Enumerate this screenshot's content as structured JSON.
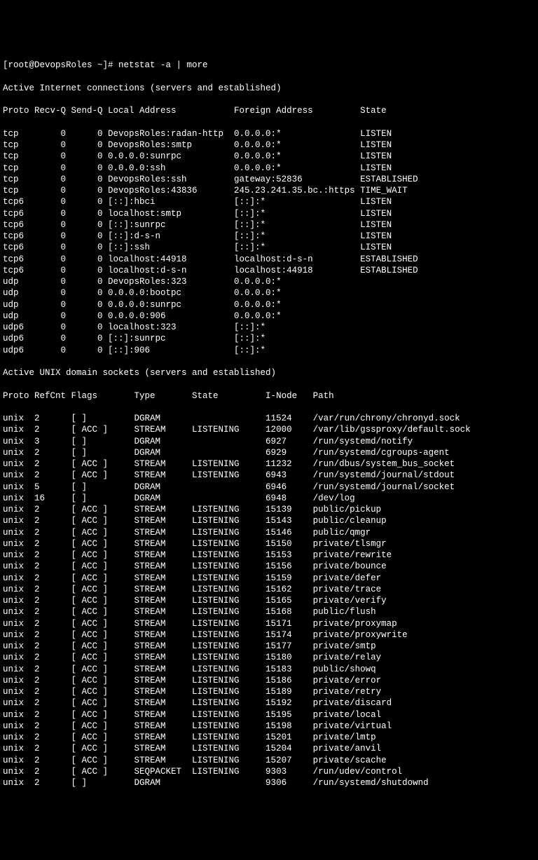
{
  "prompt": "[root@DevopsRoles ~]# netstat -a | more",
  "inet_header": "Active Internet connections (servers and established)",
  "inet_cols": "Proto Recv-Q Send-Q Local Address           Foreign Address         State",
  "inet_rows": [
    "tcp        0      0 DevopsRoles:radan-http  0.0.0.0:*               LISTEN",
    "tcp        0      0 DevopsRoles:smtp        0.0.0.0:*               LISTEN",
    "tcp        0      0 0.0.0.0:sunrpc          0.0.0.0:*               LISTEN",
    "tcp        0      0 0.0.0.0:ssh             0.0.0.0:*               LISTEN",
    "tcp        0      0 DevopsRoles:ssh         gateway:52836           ESTABLISHED",
    "tcp        0      0 DevopsRoles:43836       245.23.241.35.bc.:https TIME_WAIT",
    "tcp6       0      0 [::]:hbci               [::]:*                  LISTEN",
    "tcp6       0      0 localhost:smtp          [::]:*                  LISTEN",
    "tcp6       0      0 [::]:sunrpc             [::]:*                  LISTEN",
    "tcp6       0      0 [::]:d-s-n              [::]:*                  LISTEN",
    "tcp6       0      0 [::]:ssh                [::]:*                  LISTEN",
    "tcp6       0      0 localhost:44918         localhost:d-s-n         ESTABLISHED",
    "tcp6       0      0 localhost:d-s-n         localhost:44918         ESTABLISHED",
    "udp        0      0 DevopsRoles:323         0.0.0.0:*",
    "udp        0      0 0.0.0.0:bootpc          0.0.0.0:*",
    "udp        0      0 0.0.0.0:sunrpc          0.0.0.0:*",
    "udp        0      0 0.0.0.0:906             0.0.0.0:*",
    "udp6       0      0 localhost:323           [::]:*",
    "udp6       0      0 [::]:sunrpc             [::]:*",
    "udp6       0      0 [::]:906                [::]:*"
  ],
  "unix_header": "Active UNIX domain sockets (servers and established)",
  "unix_cols": "Proto RefCnt Flags       Type       State         I-Node   Path",
  "unix_rows": [
    "unix  2      [ ]         DGRAM                    11524    /var/run/chrony/chronyd.sock",
    "unix  2      [ ACC ]     STREAM     LISTENING     12000    /var/lib/gssproxy/default.sock",
    "unix  3      [ ]         DGRAM                    6927     /run/systemd/notify",
    "unix  2      [ ]         DGRAM                    6929     /run/systemd/cgroups-agent",
    "unix  2      [ ACC ]     STREAM     LISTENING     11232    /run/dbus/system_bus_socket",
    "unix  2      [ ACC ]     STREAM     LISTENING     6943     /run/systemd/journal/stdout",
    "unix  5      [ ]         DGRAM                    6946     /run/systemd/journal/socket",
    "unix  16     [ ]         DGRAM                    6948     /dev/log",
    "unix  2      [ ACC ]     STREAM     LISTENING     15139    public/pickup",
    "unix  2      [ ACC ]     STREAM     LISTENING     15143    public/cleanup",
    "unix  2      [ ACC ]     STREAM     LISTENING     15146    public/qmgr",
    "unix  2      [ ACC ]     STREAM     LISTENING     15150    private/tlsmgr",
    "unix  2      [ ACC ]     STREAM     LISTENING     15153    private/rewrite",
    "unix  2      [ ACC ]     STREAM     LISTENING     15156    private/bounce",
    "unix  2      [ ACC ]     STREAM     LISTENING     15159    private/defer",
    "unix  2      [ ACC ]     STREAM     LISTENING     15162    private/trace",
    "unix  2      [ ACC ]     STREAM     LISTENING     15165    private/verify",
    "unix  2      [ ACC ]     STREAM     LISTENING     15168    public/flush",
    "unix  2      [ ACC ]     STREAM     LISTENING     15171    private/proxymap",
    "unix  2      [ ACC ]     STREAM     LISTENING     15174    private/proxywrite",
    "unix  2      [ ACC ]     STREAM     LISTENING     15177    private/smtp",
    "unix  2      [ ACC ]     STREAM     LISTENING     15180    private/relay",
    "unix  2      [ ACC ]     STREAM     LISTENING     15183    public/showq",
    "unix  2      [ ACC ]     STREAM     LISTENING     15186    private/error",
    "unix  2      [ ACC ]     STREAM     LISTENING     15189    private/retry",
    "unix  2      [ ACC ]     STREAM     LISTENING     15192    private/discard",
    "unix  2      [ ACC ]     STREAM     LISTENING     15195    private/local",
    "unix  2      [ ACC ]     STREAM     LISTENING     15198    private/virtual",
    "unix  2      [ ACC ]     STREAM     LISTENING     15201    private/lmtp",
    "unix  2      [ ACC ]     STREAM     LISTENING     15204    private/anvil",
    "unix  2      [ ACC ]     STREAM     LISTENING     15207    private/scache",
    "unix  2      [ ACC ]     SEQPACKET  LISTENING     9303     /run/udev/control",
    "unix  2      [ ]         DGRAM                    9306     /run/systemd/shutdownd"
  ]
}
